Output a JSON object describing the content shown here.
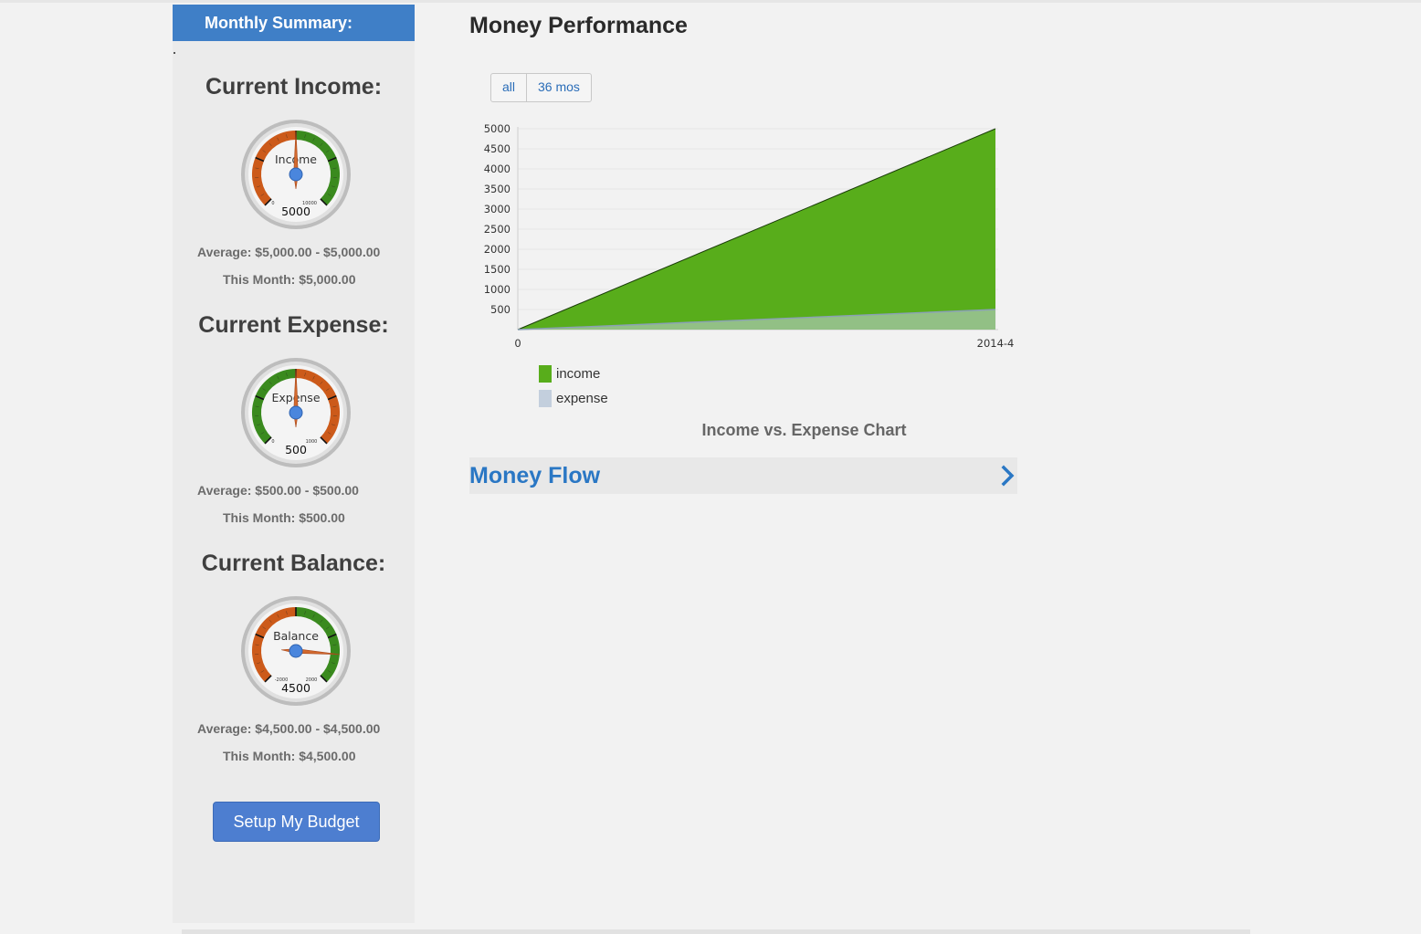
{
  "sidebar": {
    "header": "Monthly Summary:",
    "income": {
      "title": "Current Income:",
      "gauge_label": "Income",
      "gauge_value": "5000",
      "gauge_min": "0",
      "gauge_max": "10000",
      "gauge_level": 0.5,
      "average": "Average: $5,000.00 - $5,000.00",
      "this_month": "This Month: $5,000.00"
    },
    "expense": {
      "title": "Current Expense:",
      "gauge_label": "Expense",
      "gauge_value": "500",
      "gauge_min": "0",
      "gauge_max": "1000",
      "gauge_level": 0.5,
      "average": "Average: $500.00 - $500.00",
      "this_month": "This Month: $500.00"
    },
    "balance": {
      "title": "Current Balance:",
      "gauge_label": "Balance",
      "gauge_value": "4500",
      "gauge_min": "-2000",
      "gauge_max": "2000",
      "gauge_level": 0.85,
      "average": "Average: $4,500.00 - $4,500.00",
      "this_month": "This Month: $4,500.00"
    },
    "budget_button": "Setup My Budget"
  },
  "main": {
    "title": "Money Performance",
    "range_buttons": [
      "all",
      "36 mos"
    ],
    "chart_caption": "Income vs. Expense Chart",
    "money_flow": "Money Flow"
  },
  "colors": {
    "income": "#58ad1b",
    "expense": "#c3cfdd",
    "accent": "#3f7fc7",
    "gauge_green": "#3a8a1e",
    "gauge_orange": "#cc5a1a"
  },
  "chart_data": {
    "type": "area",
    "x": [
      "0",
      "2014-4"
    ],
    "series": [
      {
        "name": "income",
        "values": [
          0,
          5000
        ]
      },
      {
        "name": "expense",
        "values": [
          0,
          500
        ]
      }
    ],
    "yticks": [
      500,
      1000,
      1500,
      2000,
      2500,
      3000,
      3500,
      4000,
      4500,
      5000
    ],
    "ylim": [
      0,
      5000
    ],
    "grid": true,
    "legend": "bottom-left"
  }
}
